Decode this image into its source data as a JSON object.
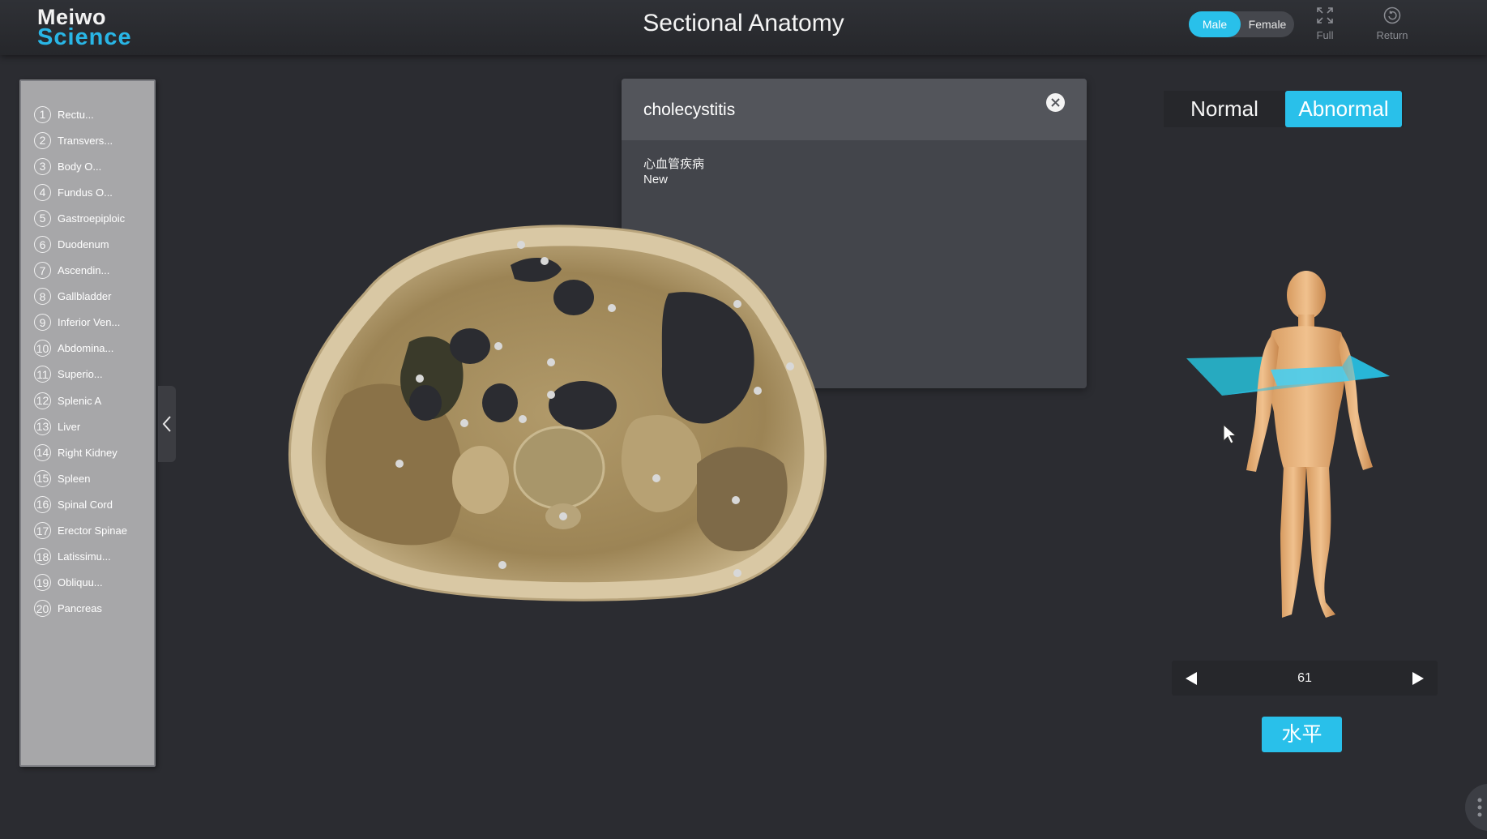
{
  "app": {
    "logo_line1": "Meiwo",
    "logo_line2": "Science",
    "title": "Sectional Anatomy"
  },
  "header": {
    "gender": {
      "male_label": "Male",
      "female_label": "Female",
      "selected": "Male"
    },
    "full_label": "Full",
    "return_label": "Return"
  },
  "sidebar": {
    "items": [
      {
        "num": "1",
        "label": "Rectu..."
      },
      {
        "num": "2",
        "label": "Transvers..."
      },
      {
        "num": "3",
        "label": "Body O..."
      },
      {
        "num": "4",
        "label": "Fundus O..."
      },
      {
        "num": "5",
        "label": "Gastroepiploic"
      },
      {
        "num": "6",
        "label": "Duodenum"
      },
      {
        "num": "7",
        "label": "Ascendin..."
      },
      {
        "num": "8",
        "label": "Gallbladder"
      },
      {
        "num": "9",
        "label": "Inferior Ven..."
      },
      {
        "num": "10",
        "label": "Abdomina..."
      },
      {
        "num": "11",
        "label": "Superio..."
      },
      {
        "num": "12",
        "label": "Splenic A"
      },
      {
        "num": "13",
        "label": "Liver"
      },
      {
        "num": "14",
        "label": "Right Kidney"
      },
      {
        "num": "15",
        "label": "Spleen"
      },
      {
        "num": "16",
        "label": "Spinal Cord"
      },
      {
        "num": "17",
        "label": "Erector Spinae"
      },
      {
        "num": "18",
        "label": "Latissimu..."
      },
      {
        "num": "19",
        "label": "Obliquu..."
      },
      {
        "num": "20",
        "label": "Pancreas"
      }
    ]
  },
  "popup": {
    "title": "cholecystitis",
    "category": "心血管疾病",
    "tag": "New"
  },
  "mode": {
    "normal_label": "Normal",
    "abnormal_label": "Abnormal",
    "selected": "Abnormal"
  },
  "slice": {
    "index": "61",
    "plane_label": "水平"
  },
  "colors": {
    "accent": "#29c0ea",
    "background": "#2b2c31",
    "sidebar": "#a7a7a9",
    "popup": "#43454b"
  }
}
